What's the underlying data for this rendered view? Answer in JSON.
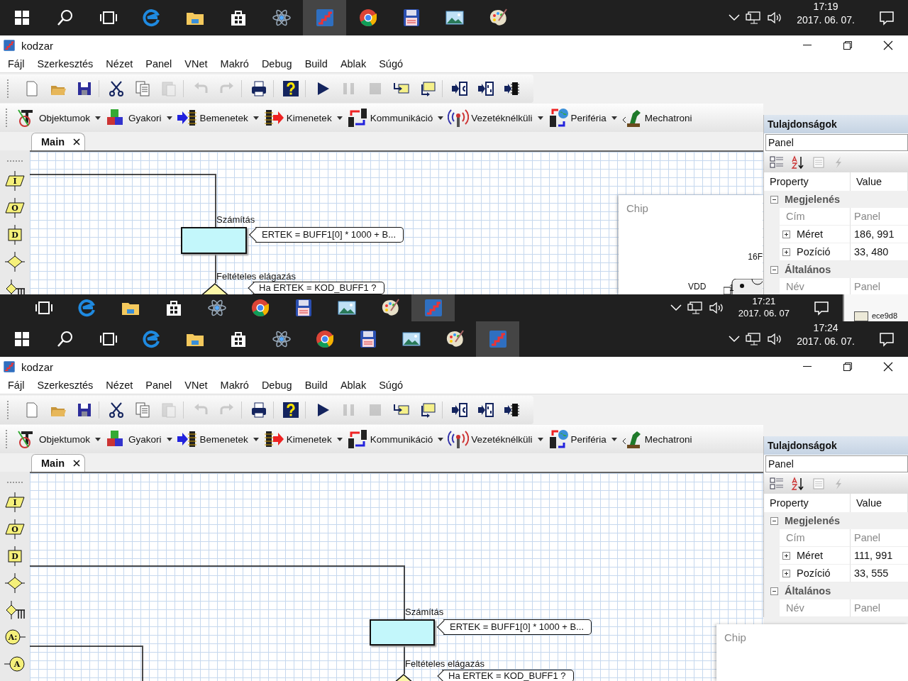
{
  "snapshots": [
    {
      "kind": "screen",
      "taskbar": {
        "apps": [
          {
            "kind": "start",
            "selected": false
          },
          {
            "kind": "search",
            "selected": false
          },
          {
            "kind": "taskview",
            "selected": false
          },
          {
            "kind": "edge",
            "selected": false
          },
          {
            "kind": "folder",
            "selected": false
          },
          {
            "kind": "store",
            "selected": false
          },
          {
            "kind": "atom",
            "selected": false
          },
          {
            "kind": "kodzar",
            "selected": true
          },
          {
            "kind": "chrome",
            "selected": false
          },
          {
            "kind": "floppy",
            "selected": false
          },
          {
            "kind": "photo",
            "selected": false
          },
          {
            "kind": "palette",
            "selected": false
          }
        ],
        "time": "17:19",
        "date": "2017. 06. 07."
      },
      "window": {
        "title": "kodzar",
        "menu": [
          "Fájl",
          "Szerkesztés",
          "Nézet",
          "Panel",
          "VNet",
          "Makró",
          "Debug",
          "Build",
          "Ablak",
          "Súgó"
        ],
        "toolbar": [
          [
            {
              "kind": "new",
              "disabled": false
            },
            {
              "kind": "open",
              "disabled": false
            },
            {
              "kind": "save",
              "disabled": false
            }
          ],
          [
            {
              "kind": "cut",
              "disabled": false
            },
            {
              "kind": "copy",
              "disabled": false
            },
            {
              "kind": "paste",
              "disabled": true
            }
          ],
          [
            {
              "kind": "undo",
              "disabled": true
            },
            {
              "kind": "redo",
              "disabled": true
            }
          ],
          [
            {
              "kind": "print",
              "disabled": false
            }
          ],
          [
            {
              "kind": "help",
              "disabled": false
            }
          ],
          [
            {
              "kind": "play",
              "disabled": false
            },
            {
              "kind": "pause",
              "disabled": true
            },
            {
              "kind": "stop",
              "disabled": true
            },
            {
              "kind": "step_in",
              "disabled": false
            },
            {
              "kind": "step_out",
              "disabled": false
            }
          ],
          [
            {
              "kind": "chip_c",
              "disabled": false
            },
            {
              "kind": "chip_io",
              "disabled": false
            },
            {
              "kind": "chip",
              "disabled": false
            }
          ]
        ],
        "object_toolbar": [
          {
            "kind": "objects",
            "label": "Objektumok",
            "dropdown": true
          },
          {
            "kind": "common",
            "label": "Gyakori",
            "dropdown": true
          },
          {
            "kind": "inputs",
            "label": "Bemenetek",
            "dropdown": true
          },
          {
            "kind": "outputs",
            "label": "Kimenetek",
            "dropdown": true
          },
          {
            "kind": "comm",
            "label": "Kommunikáció",
            "dropdown": true
          },
          {
            "kind": "wireless",
            "label": "Vezetéknélküli",
            "dropdown": true
          },
          {
            "kind": "peripheral",
            "label": "Periféria",
            "dropdown": true
          },
          {
            "kind": "mechatronic",
            "label": "Mechatroni",
            "dropdown": false
          }
        ],
        "tabs": [
          {
            "label": "Main",
            "selected": true
          }
        ],
        "palette": [
          {
            "kind": "input",
            "letter": "I"
          },
          {
            "kind": "output",
            "letter": "O"
          },
          {
            "kind": "delay",
            "letter": "D"
          },
          {
            "kind": "decision"
          },
          {
            "kind": "switch"
          }
        ],
        "flowchart": [
          {
            "kind": "process",
            "label": "Számítás",
            "comment": "ERTEK = BUFF1[0] * 1000 + B..."
          },
          {
            "kind": "decision",
            "label": "Feltételes elágazás",
            "comment": "Ha ERTEK = KOD_BUFF1 ?"
          }
        ],
        "chip_panel": {
          "title": "Chip",
          "part": "16F",
          "pin_label": "VDD",
          "pin_number": "1"
        },
        "properties": {
          "title": "Tulajdonságok",
          "object": "Panel",
          "columns": [
            "Property",
            "Value"
          ],
          "rows": [
            {
              "kind": "group",
              "name": "Megjelenés",
              "expanded": true
            },
            {
              "kind": "prop",
              "name": "Cím",
              "value": "Panel",
              "readonly": true
            },
            {
              "kind": "compound",
              "name": "Méret",
              "value": "186, 991",
              "expanded": false
            },
            {
              "kind": "compound",
              "name": "Pozíció",
              "value": "33, 480",
              "expanded": false
            },
            {
              "kind": "group",
              "name": "Általános",
              "expanded": true
            },
            {
              "kind": "prop",
              "name": "Név",
              "value": "Panel",
              "readonly": true
            }
          ]
        }
      }
    },
    {
      "kind": "taskbar_strip",
      "taskbar": {
        "apps": [
          {
            "kind": "taskview",
            "selected": false
          },
          {
            "kind": "edge",
            "selected": false
          },
          {
            "kind": "folder",
            "selected": false
          },
          {
            "kind": "store",
            "selected": false
          },
          {
            "kind": "atom",
            "selected": false
          },
          {
            "kind": "chrome",
            "selected": false
          },
          {
            "kind": "floppy",
            "selected": false
          },
          {
            "kind": "photo",
            "selected": false
          },
          {
            "kind": "palette",
            "selected": false
          },
          {
            "kind": "kodzar",
            "selected": true
          }
        ],
        "time": "17:21",
        "date": "2017. 06. 07"
      },
      "panel_fragment": {
        "color": "#ece9d8",
        "value": "ece9d8"
      }
    },
    {
      "kind": "screen",
      "taskbar": {
        "apps": [
          {
            "kind": "start",
            "selected": false
          },
          {
            "kind": "search",
            "selected": false
          },
          {
            "kind": "taskview",
            "selected": false
          },
          {
            "kind": "edge",
            "selected": false
          },
          {
            "kind": "folder",
            "selected": false
          },
          {
            "kind": "store",
            "selected": false
          },
          {
            "kind": "atom",
            "selected": false
          },
          {
            "kind": "chrome",
            "selected": false
          },
          {
            "kind": "floppy",
            "selected": false
          },
          {
            "kind": "photo",
            "selected": false
          },
          {
            "kind": "palette",
            "selected": false
          },
          {
            "kind": "kodzar",
            "selected": true
          }
        ],
        "time": "17:24",
        "date": "2017. 06. 07."
      },
      "window": {
        "title": "kodzar",
        "menu": [
          "Fájl",
          "Szerkesztés",
          "Nézet",
          "Panel",
          "VNet",
          "Makró",
          "Debug",
          "Build",
          "Ablak",
          "Súgó"
        ],
        "toolbar": [
          [
            {
              "kind": "new",
              "disabled": false
            },
            {
              "kind": "open",
              "disabled": false
            },
            {
              "kind": "save",
              "disabled": false
            }
          ],
          [
            {
              "kind": "cut",
              "disabled": false
            },
            {
              "kind": "copy",
              "disabled": false
            },
            {
              "kind": "paste",
              "disabled": true
            }
          ],
          [
            {
              "kind": "undo",
              "disabled": true
            },
            {
              "kind": "redo",
              "disabled": true
            }
          ],
          [
            {
              "kind": "print",
              "disabled": false
            }
          ],
          [
            {
              "kind": "help",
              "disabled": false
            }
          ],
          [
            {
              "kind": "play",
              "disabled": false
            },
            {
              "kind": "pause",
              "disabled": true
            },
            {
              "kind": "stop",
              "disabled": true
            },
            {
              "kind": "step_in",
              "disabled": false
            },
            {
              "kind": "step_out",
              "disabled": false
            }
          ],
          [
            {
              "kind": "chip_c",
              "disabled": false
            },
            {
              "kind": "chip_io",
              "disabled": false
            },
            {
              "kind": "chip",
              "disabled": false
            }
          ]
        ],
        "object_toolbar": [
          {
            "kind": "objects",
            "label": "Objektumok",
            "dropdown": true
          },
          {
            "kind": "common",
            "label": "Gyakori",
            "dropdown": true
          },
          {
            "kind": "inputs",
            "label": "Bemenetek",
            "dropdown": true
          },
          {
            "kind": "outputs",
            "label": "Kimenetek",
            "dropdown": true
          },
          {
            "kind": "comm",
            "label": "Kommunikáció",
            "dropdown": true
          },
          {
            "kind": "wireless",
            "label": "Vezetéknélküli",
            "dropdown": true
          },
          {
            "kind": "peripheral",
            "label": "Periféria",
            "dropdown": true
          },
          {
            "kind": "mechatronic",
            "label": "Mechatroni",
            "dropdown": false
          }
        ],
        "tabs": [
          {
            "label": "Main",
            "selected": true
          }
        ],
        "palette": [
          {
            "kind": "input",
            "letter": "I"
          },
          {
            "kind": "output",
            "letter": "O"
          },
          {
            "kind": "delay",
            "letter": "D"
          },
          {
            "kind": "decision"
          },
          {
            "kind": "switch"
          },
          {
            "kind": "label",
            "letter": "A:"
          },
          {
            "kind": "jump",
            "letter": "A"
          }
        ],
        "flowchart": [
          {
            "kind": "process",
            "label": "Számítás",
            "comment": "ERTEK = BUFF1[0] * 1000 + B..."
          },
          {
            "kind": "decision",
            "label": "Feltételes elágazás",
            "comment": "Ha ERTEK = KOD_BUFF1 ?"
          }
        ],
        "chip_panel": {
          "title": "Chip"
        },
        "properties": {
          "title": "Tulajdonságok",
          "object": "Panel",
          "columns": [
            "Property",
            "Value"
          ],
          "rows": [
            {
              "kind": "group",
              "name": "Megjelenés",
              "expanded": true
            },
            {
              "kind": "prop",
              "name": "Cím",
              "value": "Panel",
              "readonly": true
            },
            {
              "kind": "compound",
              "name": "Méret",
              "value": "111, 991",
              "expanded": false
            },
            {
              "kind": "compound",
              "name": "Pozíció",
              "value": "33, 555",
              "expanded": false
            },
            {
              "kind": "group",
              "name": "Általános",
              "expanded": true
            },
            {
              "kind": "prop",
              "name": "Név",
              "value": "Panel",
              "readonly": true
            }
          ]
        }
      }
    }
  ]
}
